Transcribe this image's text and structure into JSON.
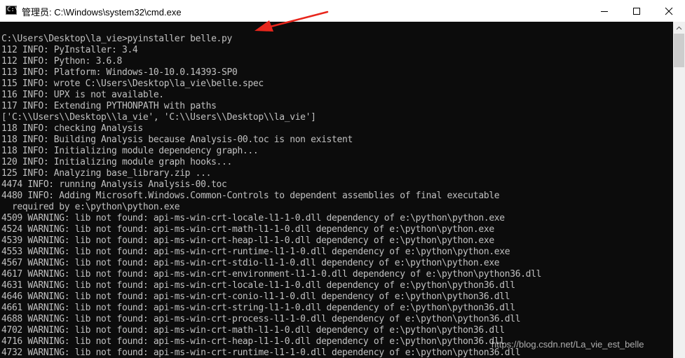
{
  "window": {
    "title": "管理员: C:\\Windows\\system32\\cmd.exe",
    "app_icon": "command-prompt-icon",
    "buttons": {
      "minimize_icon": "minimize-icon",
      "maximize_icon": "maximize-icon",
      "close_icon": "close-icon"
    }
  },
  "console": {
    "background": "#0c0c0c",
    "text_color": "#c0c0c0",
    "lines": [
      "C:\\Users\\Desktop\\la_vie>pyinstaller belle.py",
      "112 INFO: PyInstaller: 3.4",
      "112 INFO: Python: 3.6.8",
      "113 INFO: Platform: Windows-10-10.0.14393-SP0",
      "115 INFO: wrote C:\\Users\\Desktop\\la_vie\\belle.spec",
      "116 INFO: UPX is not available.",
      "117 INFO: Extending PYTHONPATH with paths",
      "['C:\\\\Users\\\\Desktop\\\\la_vie', 'C:\\\\Users\\\\Desktop\\\\la_vie']",
      "118 INFO: checking Analysis",
      "118 INFO: Building Analysis because Analysis-00.toc is non existent",
      "118 INFO: Initializing module dependency graph...",
      "120 INFO: Initializing module graph hooks...",
      "125 INFO: Analyzing base_library.zip ...",
      "4474 INFO: running Analysis Analysis-00.toc",
      "4480 INFO: Adding Microsoft.Windows.Common-Controls to dependent assemblies of final executable",
      "  required by e:\\python\\python.exe",
      "4509 WARNING: lib not found: api-ms-win-crt-locale-l1-1-0.dll dependency of e:\\python\\python.exe",
      "4524 WARNING: lib not found: api-ms-win-crt-math-l1-1-0.dll dependency of e:\\python\\python.exe",
      "4539 WARNING: lib not found: api-ms-win-crt-heap-l1-1-0.dll dependency of e:\\python\\python.exe",
      "4553 WARNING: lib not found: api-ms-win-crt-runtime-l1-1-0.dll dependency of e:\\python\\python.exe",
      "4567 WARNING: lib not found: api-ms-win-crt-stdio-l1-1-0.dll dependency of e:\\python\\python.exe",
      "4617 WARNING: lib not found: api-ms-win-crt-environment-l1-1-0.dll dependency of e:\\python\\python36.dll",
      "4631 WARNING: lib not found: api-ms-win-crt-locale-l1-1-0.dll dependency of e:\\python\\python36.dll",
      "4646 WARNING: lib not found: api-ms-win-crt-conio-l1-1-0.dll dependency of e:\\python\\python36.dll",
      "4661 WARNING: lib not found: api-ms-win-crt-string-l1-1-0.dll dependency of e:\\python\\python36.dll",
      "4688 WARNING: lib not found: api-ms-win-crt-process-l1-1-0.dll dependency of e:\\python\\python36.dll",
      "4702 WARNING: lib not found: api-ms-win-crt-math-l1-1-0.dll dependency of e:\\python\\python36.dll",
      "4716 WARNING: lib not found: api-ms-win-crt-heap-l1-1-0.dll dependency of e:\\python\\python36.dll",
      "4732 WARNING: lib not found: api-ms-win-crt-runtime-l1-1-0.dll dependency of e:\\python\\python36.dll"
    ]
  },
  "annotation": {
    "arrow_icon": "red-arrow-icon",
    "color": "#e8261c"
  },
  "watermark": {
    "text": "https://blog.csdn.net/La_vie_est_belle"
  }
}
